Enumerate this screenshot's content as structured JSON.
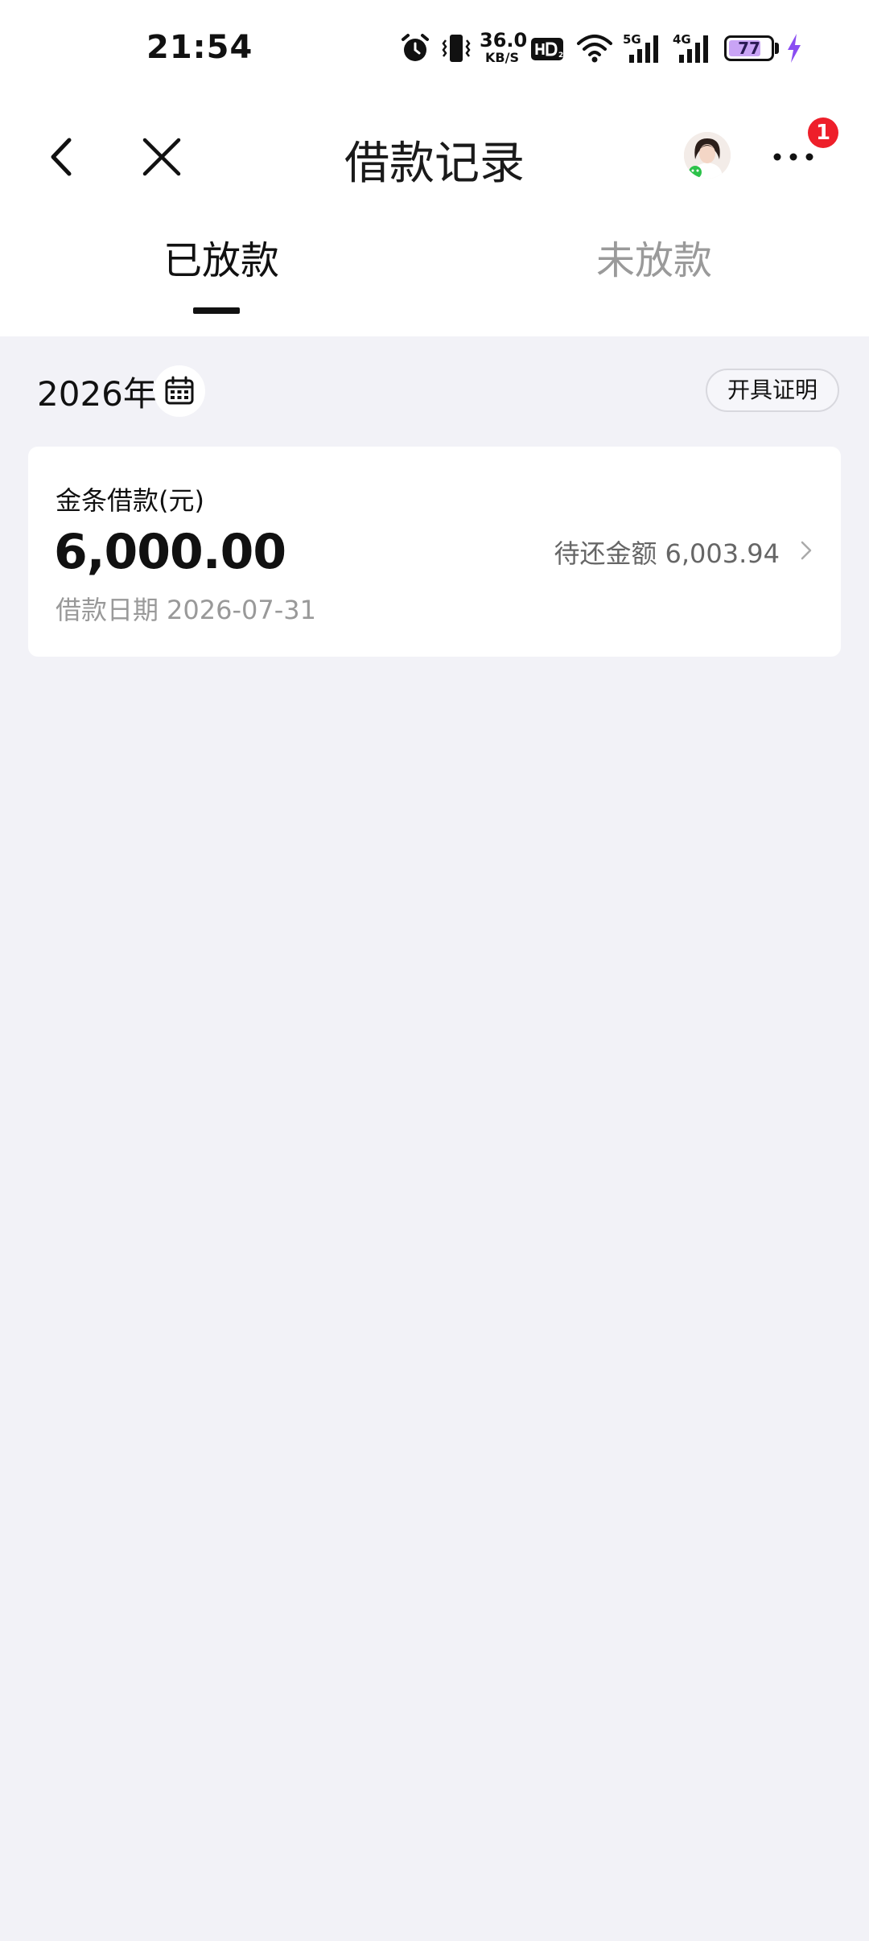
{
  "status_bar": {
    "time": "21:54",
    "net_speed_value": "36.0",
    "net_speed_unit": "KB/S",
    "battery_level": "77",
    "icons": [
      "alarm-icon",
      "vibrate-icon",
      "hd-icon",
      "wifi-icon",
      "5g-signal-icon",
      "4g-signal-icon",
      "battery-icon",
      "charging-icon"
    ]
  },
  "header": {
    "title": "借款记录",
    "notification_count": "1",
    "icons": [
      "back-icon",
      "close-icon",
      "avatar",
      "more-icon"
    ]
  },
  "tabs": [
    {
      "label": "已放款",
      "active": true
    },
    {
      "label": "未放款",
      "active": false
    }
  ],
  "filter": {
    "year": "2026年",
    "certificate_button": "开具证明"
  },
  "loans": [
    {
      "name": "金条借款(元)",
      "amount": "6,000.00",
      "date_label": "借款日期",
      "date": "2026-07-31",
      "due_label": "待还金额",
      "due_amount": "6,003.94"
    }
  ],
  "colors": {
    "page_background": "#f2f2f7",
    "card_background": "#ffffff",
    "badge": "#ee1f2a",
    "battery_fill": "#c9a4f5",
    "charging": "#8a4df2",
    "secondary_text": "#999999"
  }
}
